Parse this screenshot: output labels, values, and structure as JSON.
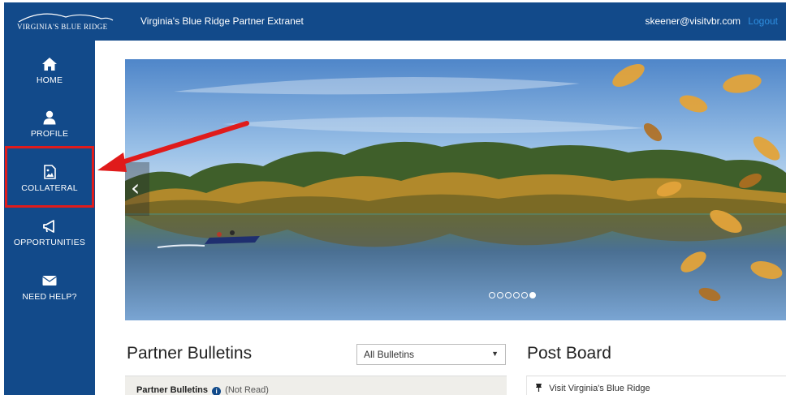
{
  "header": {
    "logo_text": "VIRGINIA'S BLUE RIDGE",
    "app_title": "Virginia's Blue Ridge Partner Extranet",
    "user_email": "skeener@visitvbr.com",
    "logout_label": "Logout"
  },
  "sidebar": {
    "items": [
      {
        "label": "HOME",
        "icon": "home-icon"
      },
      {
        "label": "PROFILE",
        "icon": "user-icon"
      },
      {
        "label": "COLLATERAL",
        "icon": "image-file-icon"
      },
      {
        "label": "OPPORTUNITIES",
        "icon": "megaphone-icon"
      },
      {
        "label": "NEED HELP?",
        "icon": "envelope-icon"
      }
    ]
  },
  "carousel": {
    "slide_count": 6,
    "active_index": 5
  },
  "bulletins": {
    "title": "Partner Bulletins",
    "filter_selected": "All Bulletins",
    "panel_heading": "Partner Bulletins",
    "panel_status": "(Not Read)"
  },
  "post_board": {
    "title": "Post Board",
    "items": [
      "Visit Virginia's Blue Ridge"
    ]
  },
  "colors": {
    "brand_blue": "#124a8a",
    "link_blue": "#2f8fe0",
    "highlight_red": "#e01b1b"
  }
}
